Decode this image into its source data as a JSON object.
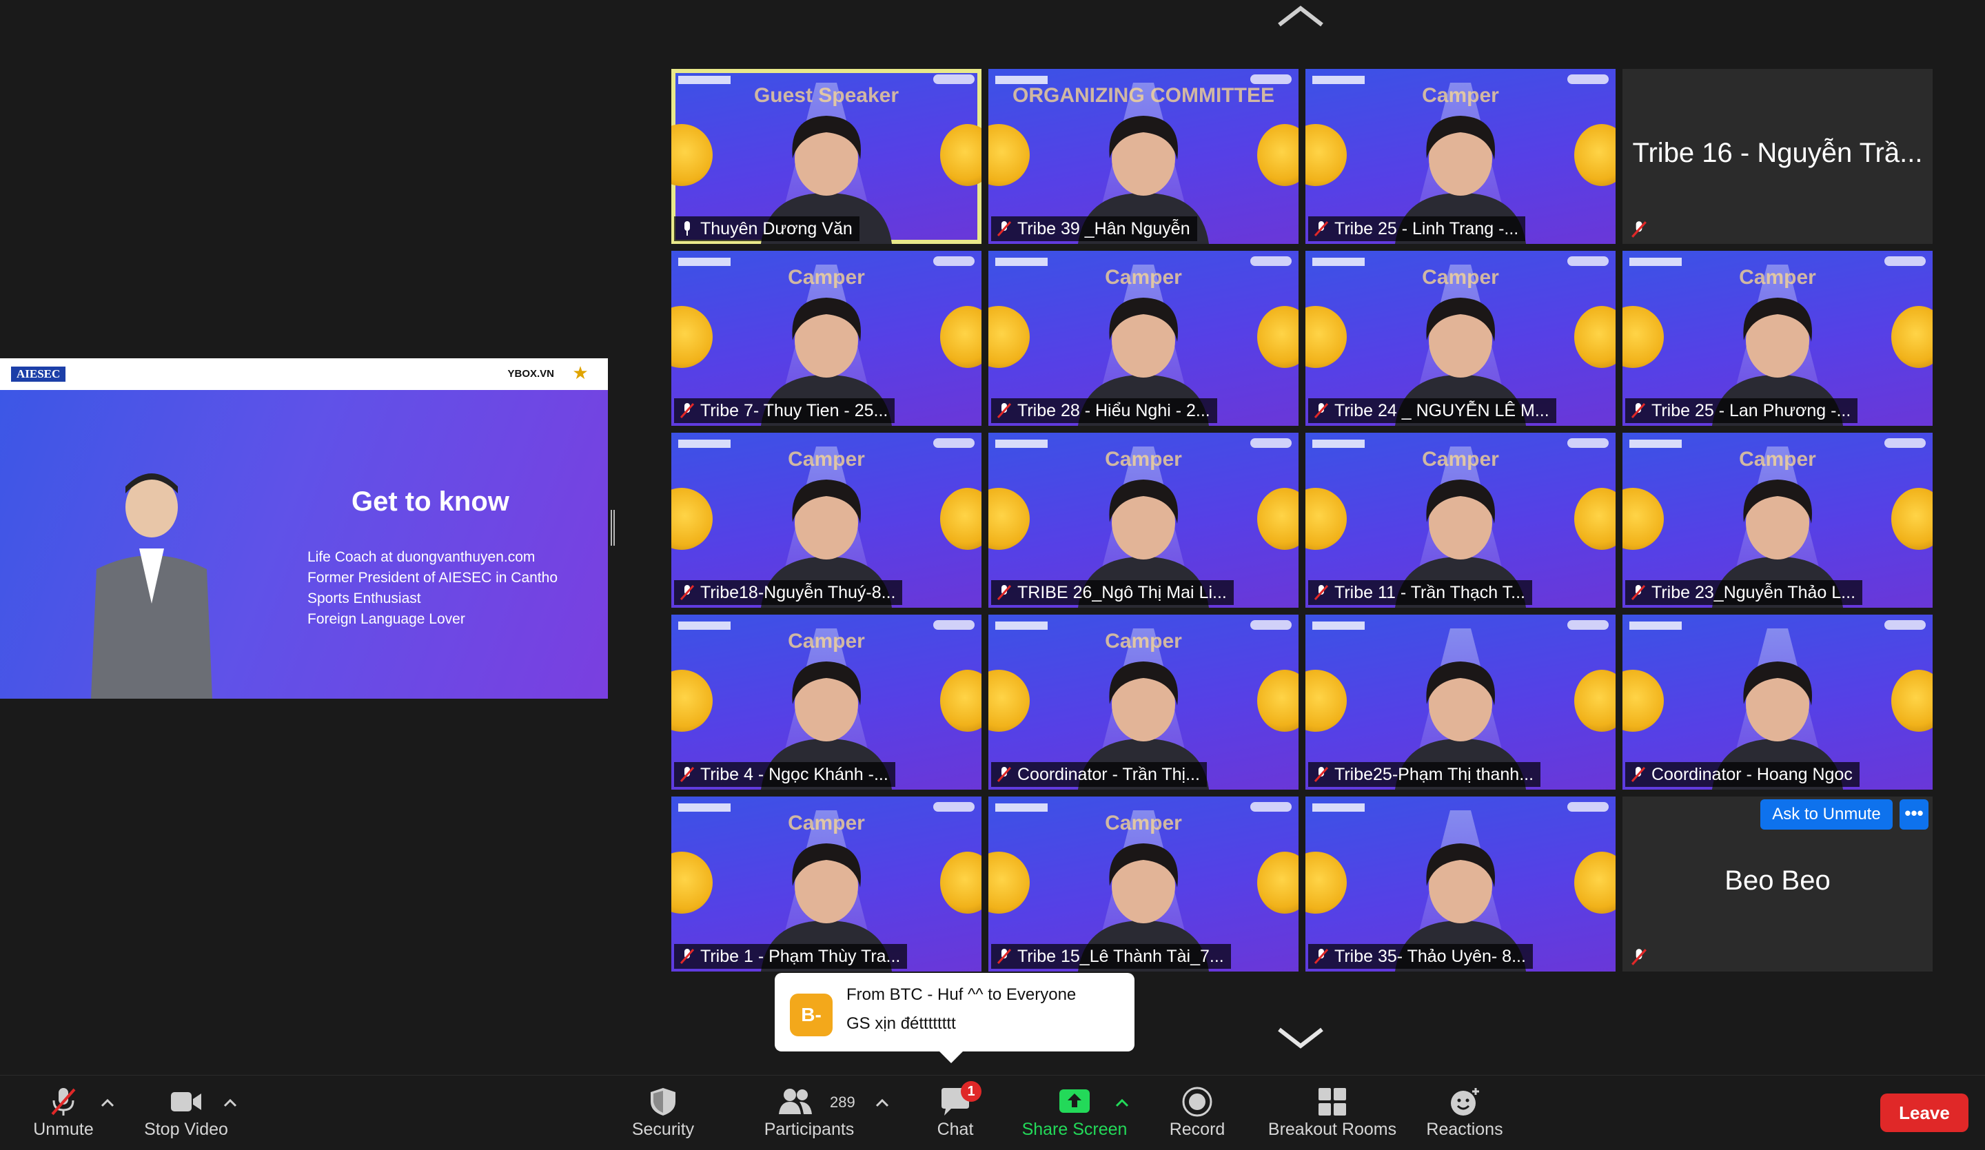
{
  "shared_screen": {
    "logo_left": "AIESEC",
    "logo_right": "YBOX.VN",
    "title": "Get to know",
    "lines": [
      "Life Coach at duongvanthuyen.com",
      "Former President of AIESEC in Cantho",
      "Sports Enthusiast",
      "Foreign Language Lover"
    ]
  },
  "participants": [
    {
      "name": "Thuyên Dương Văn",
      "kind": "video",
      "active": true,
      "overlay": "Guest Speaker"
    },
    {
      "name": "Tribe 39 _Hân Nguyễn",
      "kind": "video",
      "overlay": "ORGANIZING COMMITTEE"
    },
    {
      "name": "Tribe 25 - Linh Trang -...",
      "kind": "video",
      "overlay": "Camper"
    },
    {
      "name": "Tribe 16 - Nguyễn Trầ...",
      "kind": "name-only"
    },
    {
      "name": "Tribe 7- Thuy Tien - 25...",
      "kind": "video",
      "overlay": "Camper"
    },
    {
      "name": "Tribe 28 - Hiểu Nghi - 2...",
      "kind": "video",
      "overlay": "Camper"
    },
    {
      "name": "Tribe 24 _ NGUYỄN LÊ M...",
      "kind": "video",
      "overlay": "Camper"
    },
    {
      "name": "Tribe 25 - Lan Phương -...",
      "kind": "video",
      "overlay": "Camper"
    },
    {
      "name": "Tribe18-Nguyễn Thuý-8...",
      "kind": "video",
      "overlay": "Camper"
    },
    {
      "name": "TRIBE 26_Ngô Thị Mai Li...",
      "kind": "video",
      "overlay": "Camper"
    },
    {
      "name": "Tribe 11 - Trần Thạch T...",
      "kind": "video",
      "overlay": "Camper"
    },
    {
      "name": "Tribe 23_Nguyễn Thảo L...",
      "kind": "video",
      "overlay": "Camper"
    },
    {
      "name": "Tribe 4 - Ngọc Khánh -...",
      "kind": "video",
      "overlay": "Camper"
    },
    {
      "name": "Coordinator - Trần Thị...",
      "kind": "video",
      "overlay": "Camper"
    },
    {
      "name": "Tribe25-Phạm Thị thanh...",
      "kind": "video",
      "overlay": ""
    },
    {
      "name": "Coordinator - Hoang Ngoc",
      "kind": "video",
      "overlay": ""
    },
    {
      "name": "Tribe 1 - Phạm Thùy Tra...",
      "kind": "video",
      "overlay": "Camper"
    },
    {
      "name": "Tribe 15_Lê Thành Tài_7...",
      "kind": "video",
      "overlay": "Camper"
    },
    {
      "name": "Tribe 35- Thảo Uyên- 8...",
      "kind": "video",
      "overlay": ""
    },
    {
      "name": "Beo Beo",
      "kind": "name-only"
    }
  ],
  "ask_to_unmute": "Ask to Unmute",
  "more_label": "•••",
  "chat_toast": {
    "avatar": "B-",
    "from": "From BTC - Huf ^^ to Everyone",
    "message": "GS xịn đétttttttt"
  },
  "toolbar": {
    "unmute": "Unmute",
    "stop_video": "Stop Video",
    "security": "Security",
    "participants": "Participants",
    "participants_count": "289",
    "chat": "Chat",
    "chat_unread": "1",
    "share_screen": "Share Screen",
    "record": "Record",
    "breakout_rooms": "Breakout Rooms",
    "reactions": "Reactions",
    "leave": "Leave"
  },
  "colors": {
    "accent_blue": "#0e72ed",
    "share_green": "#23d959",
    "leave_red": "#e02828",
    "active_speaker": "#e9e98a",
    "toast_avatar": "#f3a81b"
  }
}
